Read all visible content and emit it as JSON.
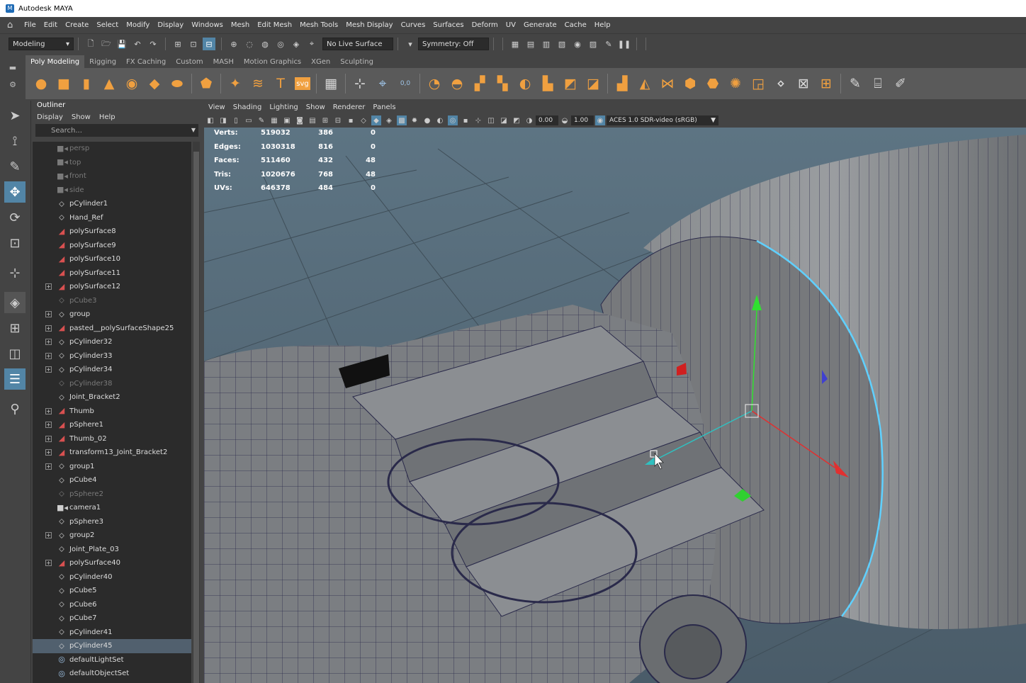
{
  "app_title": "Autodesk MAYA",
  "menubar": [
    "File",
    "Edit",
    "Create",
    "Select",
    "Modify",
    "Display",
    "Windows",
    "Mesh",
    "Edit Mesh",
    "Mesh Tools",
    "Mesh Display",
    "Curves",
    "Surfaces",
    "Deform",
    "UV",
    "Generate",
    "Cache",
    "Help"
  ],
  "statusline": {
    "workspace": "Modeling",
    "live_surface": "No Live Surface",
    "symmetry": "Symmetry: Off"
  },
  "shelf_tabs": [
    "Poly Modeling",
    "Rigging",
    "FX Caching",
    "Custom",
    "MASH",
    "Motion Graphics",
    "XGen",
    "Sculpting"
  ],
  "shelf_text_icons": {
    "type": "T",
    "svg": "svg",
    "count": "0,0"
  },
  "outliner": {
    "title": "Outliner",
    "menu": [
      "Display",
      "Show",
      "Help"
    ],
    "search_placeholder": "Search...",
    "items": [
      {
        "label": "persp",
        "icon": "camera-icon",
        "dim": true,
        "expand": false
      },
      {
        "label": "top",
        "icon": "camera-icon",
        "dim": true,
        "expand": false
      },
      {
        "label": "front",
        "icon": "camera-icon",
        "dim": true,
        "expand": false
      },
      {
        "label": "side",
        "icon": "camera-icon",
        "dim": true,
        "expand": false
      },
      {
        "label": "pCylinder1",
        "icon": "transform-icon",
        "dim": false,
        "expand": false
      },
      {
        "label": "Hand_Ref",
        "icon": "transform-icon",
        "dim": false,
        "expand": false
      },
      {
        "label": "polySurface8",
        "icon": "mesh-icon",
        "dim": false,
        "expand": false
      },
      {
        "label": "polySurface9",
        "icon": "mesh-icon",
        "dim": false,
        "expand": false
      },
      {
        "label": "polySurface10",
        "icon": "mesh-icon",
        "dim": false,
        "expand": false
      },
      {
        "label": "polySurface11",
        "icon": "mesh-icon",
        "dim": false,
        "expand": false
      },
      {
        "label": "polySurface12",
        "icon": "mesh-icon",
        "dim": false,
        "expand": true
      },
      {
        "label": "pCube3",
        "icon": "transform-icon",
        "dim": true,
        "expand": false
      },
      {
        "label": "group",
        "icon": "transform-icon",
        "dim": false,
        "expand": true
      },
      {
        "label": "pasted__polySurfaceShape25",
        "icon": "mesh-icon",
        "dim": false,
        "expand": true
      },
      {
        "label": "pCylinder32",
        "icon": "transform-icon",
        "dim": false,
        "expand": true
      },
      {
        "label": "pCylinder33",
        "icon": "transform-icon",
        "dim": false,
        "expand": true
      },
      {
        "label": "pCylinder34",
        "icon": "transform-icon",
        "dim": false,
        "expand": true
      },
      {
        "label": "pCylinder38",
        "icon": "transform-icon",
        "dim": true,
        "expand": false
      },
      {
        "label": "Joint_Bracket2",
        "icon": "transform-icon",
        "dim": false,
        "expand": false
      },
      {
        "label": "Thumb",
        "icon": "mesh-icon",
        "dim": false,
        "expand": true
      },
      {
        "label": "pSphere1",
        "icon": "mesh-icon",
        "dim": false,
        "expand": true
      },
      {
        "label": "Thumb_02",
        "icon": "mesh-icon",
        "dim": false,
        "expand": true
      },
      {
        "label": "transform13_Joint_Bracket2",
        "icon": "mesh-icon",
        "dim": false,
        "expand": true
      },
      {
        "label": "group1",
        "icon": "transform-icon",
        "dim": false,
        "expand": true
      },
      {
        "label": "pCube4",
        "icon": "transform-icon",
        "dim": false,
        "expand": false
      },
      {
        "label": "pSphere2",
        "icon": "transform-icon",
        "dim": true,
        "expand": false
      },
      {
        "label": "camera1",
        "icon": "camera-icon",
        "dim": false,
        "expand": false
      },
      {
        "label": "pSphere3",
        "icon": "transform-icon",
        "dim": false,
        "expand": false
      },
      {
        "label": "group2",
        "icon": "transform-icon",
        "dim": false,
        "expand": true
      },
      {
        "label": "Joint_Plate_03",
        "icon": "transform-icon",
        "dim": false,
        "expand": false
      },
      {
        "label": "polySurface40",
        "icon": "mesh-icon",
        "dim": false,
        "expand": true
      },
      {
        "label": "pCylinder40",
        "icon": "transform-icon",
        "dim": false,
        "expand": false
      },
      {
        "label": "pCube5",
        "icon": "transform-icon",
        "dim": false,
        "expand": false
      },
      {
        "label": "pCube6",
        "icon": "transform-icon",
        "dim": false,
        "expand": false
      },
      {
        "label": "pCube7",
        "icon": "transform-icon",
        "dim": false,
        "expand": false
      },
      {
        "label": "pCylinder41",
        "icon": "transform-icon",
        "dim": false,
        "expand": false
      },
      {
        "label": "pCylinder45",
        "icon": "transform-icon",
        "dim": false,
        "expand": false,
        "selected": true
      },
      {
        "label": "defaultLightSet",
        "icon": "set-icon",
        "dim": false,
        "expand": false
      },
      {
        "label": "defaultObjectSet",
        "icon": "set-icon",
        "dim": false,
        "expand": false
      }
    ]
  },
  "viewport": {
    "menu": [
      "View",
      "Shading",
      "Lighting",
      "Show",
      "Renderer",
      "Panels"
    ],
    "exposure": "0.00",
    "gamma": "1.00",
    "color_space": "ACES 1.0 SDR-video (sRGB)",
    "hud": [
      {
        "label": "Verts:",
        "a": "519032",
        "b": "386",
        "c": "0"
      },
      {
        "label": "Edges:",
        "a": "1030318",
        "b": "816",
        "c": "0"
      },
      {
        "label": "Faces:",
        "a": "511460",
        "b": "432",
        "c": "48"
      },
      {
        "label": "Tris:",
        "a": "1020676",
        "b": "768",
        "c": "48"
      },
      {
        "label": "UVs:",
        "a": "646378",
        "b": "484",
        "c": "0"
      }
    ]
  },
  "colors": {
    "accent": "#5285a6",
    "shelf_icon": "#f0a040",
    "selection_edge": "#5fd0ff",
    "gizmo_x": "#e03030",
    "gizmo_y": "#30e030",
    "gizmo_z": "#4040ff"
  }
}
